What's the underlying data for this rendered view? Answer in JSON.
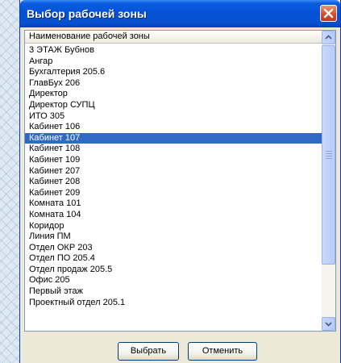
{
  "window": {
    "title": "Выбор рабочей зоны"
  },
  "list": {
    "column_header": "Наименование рабочей зоны",
    "items": [
      "3 ЭТАЖ Бубнов",
      "Ангар",
      "Бухгалтерия 205.6",
      "ГлавБух 206",
      "Директор",
      "Директор СУПЦ",
      "ИТО 305",
      "Кабинет 106",
      "Кабинет 107",
      "Кабинет 108",
      "Кабинет 109",
      "Кабинет 207",
      "Кабинет 208",
      "Кабинет 209",
      "Комната 101",
      "Комната 104",
      "Коридор",
      "Линия ПМ",
      "Отдел ОКР 203",
      "Отдел ПО 205.4",
      "Отдел продаж 205.5",
      "Офис 205",
      "Первый этаж",
      "Проектный отдел 205.1"
    ],
    "selected_item": "Кабинет 107"
  },
  "buttons": {
    "select_label": "Выбрать",
    "cancel_label": "Отменить"
  },
  "colors": {
    "selection": "#316ac5",
    "titlebar": "#0553d8",
    "close": "#d9542a"
  },
  "icons": {
    "close": "close-icon",
    "scroll_up": "scroll-up-arrow-icon",
    "scroll_down": "scroll-down-arrow-icon"
  }
}
